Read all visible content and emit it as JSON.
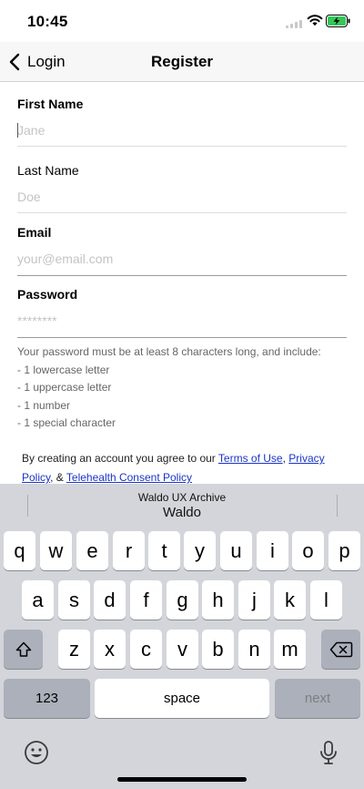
{
  "status_bar": {
    "time": "10:45"
  },
  "nav": {
    "back_label": "Login",
    "title": "Register"
  },
  "form": {
    "first_name": {
      "label": "First Name",
      "placeholder": "Jane"
    },
    "last_name": {
      "label": "Last Name",
      "placeholder": "Doe"
    },
    "email": {
      "label": "Email",
      "placeholder": "your@email.com"
    },
    "password": {
      "label": "Password",
      "placeholder": "********"
    }
  },
  "password_hint": {
    "intro": "Your password must be at least 8 characters long, and include:",
    "rules": [
      "- 1 lowercase letter",
      "- 1 uppercase letter",
      "- 1 number",
      "- 1 special character"
    ]
  },
  "terms": {
    "prefix": "By creating an account you agree to our ",
    "terms_link": "Terms of Use",
    "sep1": ", ",
    "privacy_link": "Privacy Policy",
    "sep2": ", & ",
    "telehealth_link": "Telehealth Consent Policy"
  },
  "keyboard": {
    "suggestion_small": "Waldo UX Archive",
    "suggestion_big": "Waldo",
    "row1": [
      "q",
      "w",
      "e",
      "r",
      "t",
      "y",
      "u",
      "i",
      "o",
      "p"
    ],
    "row2": [
      "a",
      "s",
      "d",
      "f",
      "g",
      "h",
      "j",
      "k",
      "l"
    ],
    "row3": [
      "z",
      "x",
      "c",
      "v",
      "b",
      "n",
      "m"
    ],
    "numbers_label": "123",
    "space_label": "space",
    "next_label": "next",
    "icons": [
      "shift-icon",
      "backspace-icon",
      "emoji-icon",
      "microphone-icon"
    ]
  },
  "colors": {
    "link": "#1a35c7",
    "battery_charging": "#34c759",
    "keyboard_bg": "#d3d5da"
  }
}
